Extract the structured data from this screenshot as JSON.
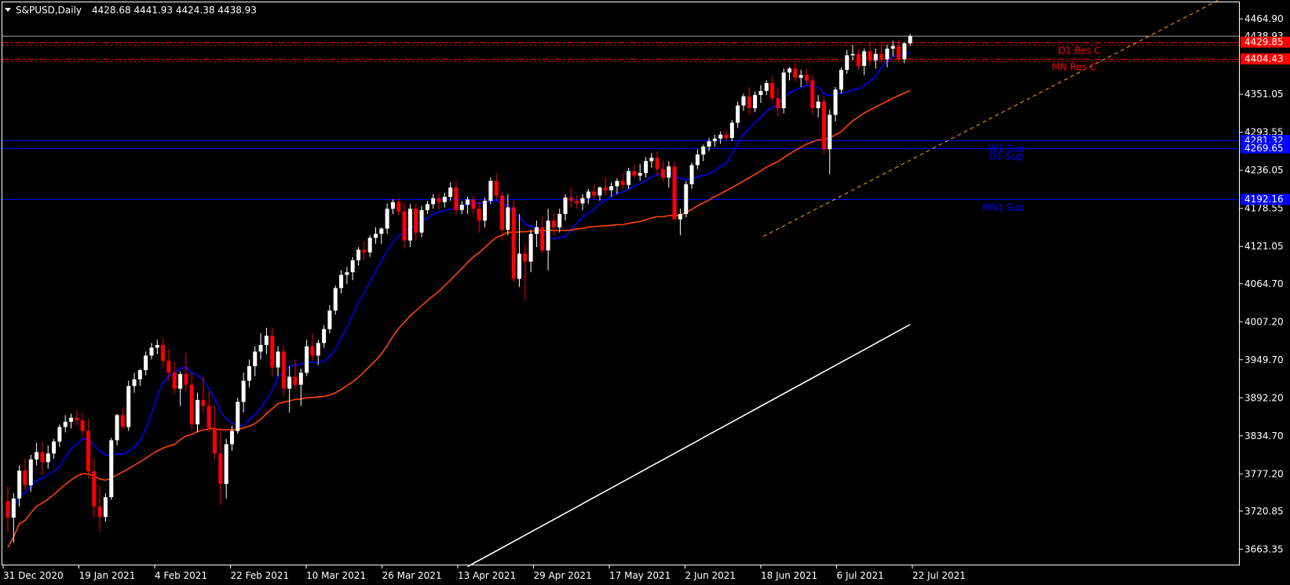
{
  "header": {
    "symbol": "S&PUSD,Daily",
    "ohlc": "4428.68 4441.93 4424.38 4438.93"
  },
  "chart_data": {
    "type": "candlestick",
    "title": "S&PUSD,Daily",
    "ylim": [
      3640,
      4490
    ],
    "y_ticks": [
      "4464.90",
      "4351.05",
      "4293.55",
      "4236.05",
      "4178.55",
      "4121.05",
      "4064.70",
      "4007.20",
      "3949.70",
      "3892.20",
      "3834.70",
      "3777.20",
      "3720.85",
      "3663.35"
    ],
    "x_ticks": [
      "31 Dec 2020",
      "19 Jan 2021",
      "4 Feb 2021",
      "22 Feb 2021",
      "10 Mar 2021",
      "26 Mar 2021",
      "13 Apr 2021",
      "29 Apr 2021",
      "17 May 2021",
      "2 Jun 2021",
      "18 Jun 2021",
      "6 Jul 2021",
      "22 Jul 2021"
    ],
    "last_price": "4438.93",
    "levels": [
      {
        "name": "D1 Res C",
        "price": 4429.85,
        "label": "4429.85",
        "color": "#ff0000",
        "style": "dashdot"
      },
      {
        "name": "MN Res C",
        "price": 4404.43,
        "label": "4404.43",
        "color": "#ff0000",
        "style": "dashdot"
      },
      {
        "name": "W1 Sup",
        "price": 4281.32,
        "label": "4281.32",
        "color": "#0000ff",
        "style": "solid"
      },
      {
        "name": "D1 Sup",
        "price": 4269.65,
        "label": "4269.65",
        "color": "#0000ff",
        "style": "solid"
      },
      {
        "name": "MN1 Sup",
        "price": 4192.16,
        "label": "4192.16",
        "color": "#0000ff",
        "style": "solid"
      }
    ],
    "trendline": {
      "start": {
        "date": "18 Jun 2021",
        "price": 4136
      },
      "end": {
        "date": "Aug 2021",
        "price": 4496
      },
      "color": "#ffa500",
      "style": "dashed"
    },
    "moving_averages": [
      {
        "color": "#0000ff",
        "period_label": "short"
      },
      {
        "color": "#ff4500",
        "period_label": "medium"
      },
      {
        "color": "#ffffff",
        "period_label": "long"
      }
    ],
    "candles": [
      [
        3736,
        3758,
        3690,
        3711
      ],
      [
        3711,
        3748,
        3673,
        3740
      ],
      [
        3740,
        3790,
        3728,
        3782
      ],
      [
        3782,
        3800,
        3752,
        3760
      ],
      [
        3760,
        3806,
        3750,
        3799
      ],
      [
        3799,
        3824,
        3790,
        3810
      ],
      [
        3810,
        3826,
        3775,
        3795
      ],
      [
        3795,
        3820,
        3785,
        3808
      ],
      [
        3808,
        3830,
        3800,
        3826
      ],
      [
        3826,
        3852,
        3818,
        3848
      ],
      [
        3848,
        3866,
        3840,
        3856
      ],
      [
        3856,
        3868,
        3846,
        3862
      ],
      [
        3862,
        3872,
        3850,
        3858
      ],
      [
        3858,
        3870,
        3836,
        3842
      ],
      [
        3842,
        3860,
        3770,
        3781
      ],
      [
        3781,
        3800,
        3712,
        3728
      ],
      [
        3728,
        3760,
        3690,
        3712
      ],
      [
        3712,
        3748,
        3705,
        3742
      ],
      [
        3742,
        3832,
        3738,
        3828
      ],
      [
        3828,
        3868,
        3820,
        3866
      ],
      [
        3866,
        3878,
        3845,
        3848
      ],
      [
        3848,
        3918,
        3842,
        3910
      ],
      [
        3910,
        3930,
        3900,
        3920
      ],
      [
        3920,
        3936,
        3910,
        3934
      ],
      [
        3934,
        3962,
        3926,
        3956
      ],
      [
        3956,
        3975,
        3950,
        3968
      ],
      [
        3968,
        3980,
        3958,
        3972
      ],
      [
        3972,
        3982,
        3938,
        3948
      ],
      [
        3948,
        3966,
        3918,
        3930
      ],
      [
        3930,
        3946,
        3898,
        3906
      ],
      [
        3906,
        3932,
        3880,
        3928
      ],
      [
        3928,
        3960,
        3902,
        3912
      ],
      [
        3912,
        3930,
        3842,
        3852
      ],
      [
        3852,
        3900,
        3840,
        3889
      ],
      [
        3889,
        3924,
        3870,
        3880
      ],
      [
        3880,
        3902,
        3840,
        3846
      ],
      [
        3846,
        3880,
        3800,
        3808
      ],
      [
        3808,
        3848,
        3730,
        3762
      ],
      [
        3762,
        3830,
        3740,
        3822
      ],
      [
        3822,
        3850,
        3812,
        3842
      ],
      [
        3842,
        3892,
        3838,
        3886
      ],
      [
        3886,
        3930,
        3870,
        3918
      ],
      [
        3918,
        3950,
        3908,
        3940
      ],
      [
        3940,
        3970,
        3925,
        3962
      ],
      [
        3962,
        3990,
        3950,
        3972
      ],
      [
        3972,
        3998,
        3958,
        3986
      ],
      [
        3986,
        3998,
        3925,
        3938
      ],
      [
        3938,
        3970,
        3925,
        3962
      ],
      [
        3962,
        3970,
        3895,
        3906
      ],
      [
        3906,
        3940,
        3870,
        3924
      ],
      [
        3924,
        3950,
        3905,
        3912
      ],
      [
        3912,
        3936,
        3880,
        3930
      ],
      [
        3930,
        3980,
        3925,
        3970
      ],
      [
        3970,
        3990,
        3948,
        3956
      ],
      [
        3956,
        3980,
        3942,
        3975
      ],
      [
        3975,
        4002,
        3968,
        3996
      ],
      [
        3996,
        4032,
        3990,
        4024
      ],
      [
        4024,
        4062,
        4018,
        4058
      ],
      [
        4058,
        4085,
        4050,
        4078
      ],
      [
        4078,
        4090,
        4064,
        4082
      ],
      [
        4082,
        4105,
        4070,
        4100
      ],
      [
        4100,
        4120,
        4092,
        4116
      ],
      [
        4116,
        4128,
        4100,
        4112
      ],
      [
        4112,
        4138,
        4105,
        4134
      ],
      [
        4134,
        4150,
        4125,
        4140
      ],
      [
        4140,
        4150,
        4125,
        4148
      ],
      [
        4148,
        4186,
        4140,
        4178
      ],
      [
        4178,
        4192,
        4170,
        4188
      ],
      [
        4188,
        4194,
        4168,
        4174
      ],
      [
        4174,
        4186,
        4118,
        4130
      ],
      [
        4130,
        4185,
        4120,
        4178
      ],
      [
        4178,
        4186,
        4130,
        4142
      ],
      [
        4142,
        4182,
        4135,
        4176
      ],
      [
        4176,
        4190,
        4170,
        4185
      ],
      [
        4185,
        4200,
        4178,
        4194
      ],
      [
        4194,
        4200,
        4176,
        4188
      ],
      [
        4188,
        4202,
        4180,
        4196
      ],
      [
        4196,
        4218,
        4190,
        4210
      ],
      [
        4210,
        4220,
        4168,
        4176
      ],
      [
        4176,
        4190,
        4170,
        4184
      ],
      [
        4184,
        4196,
        4170,
        4192
      ],
      [
        4192,
        4198,
        4170,
        4178
      ],
      [
        4178,
        4188,
        4142,
        4160
      ],
      [
        4160,
        4195,
        4150,
        4190
      ],
      [
        4190,
        4225,
        4185,
        4220
      ],
      [
        4220,
        4232,
        4190,
        4198
      ],
      [
        4198,
        4204,
        4130,
        4146
      ],
      [
        4146,
        4200,
        4138,
        4180
      ],
      [
        4180,
        4190,
        4068,
        4072
      ],
      [
        4072,
        4170,
        4060,
        4110
      ],
      [
        4110,
        4124,
        4040,
        4098
      ],
      [
        4098,
        4146,
        4082,
        4140
      ],
      [
        4140,
        4160,
        4120,
        4150
      ],
      [
        4150,
        4166,
        4110,
        4115
      ],
      [
        4115,
        4178,
        4085,
        4160
      ],
      [
        4160,
        4172,
        4138,
        4150
      ],
      [
        4150,
        4178,
        4142,
        4170
      ],
      [
        4170,
        4200,
        4160,
        4195
      ],
      [
        4195,
        4210,
        4180,
        4190
      ],
      [
        4190,
        4198,
        4178,
        4186
      ],
      [
        4186,
        4200,
        4176,
        4194
      ],
      [
        4194,
        4208,
        4185,
        4204
      ],
      [
        4204,
        4215,
        4192,
        4198
      ],
      [
        4198,
        4212,
        4190,
        4210
      ],
      [
        4210,
        4225,
        4198,
        4206
      ],
      [
        4206,
        4218,
        4196,
        4212
      ],
      [
        4212,
        4224,
        4200,
        4220
      ],
      [
        4220,
        4232,
        4208,
        4214
      ],
      [
        4214,
        4240,
        4208,
        4235
      ],
      [
        4235,
        4245,
        4225,
        4228
      ],
      [
        4228,
        4246,
        4220,
        4232
      ],
      [
        4232,
        4256,
        4225,
        4250
      ],
      [
        4250,
        4262,
        4240,
        4255
      ],
      [
        4255,
        4265,
        4228,
        4238
      ],
      [
        4238,
        4250,
        4220,
        4225
      ],
      [
        4225,
        4250,
        4210,
        4242
      ],
      [
        4242,
        4248,
        4175,
        4162
      ],
      [
        4162,
        4178,
        4138,
        4170
      ],
      [
        4170,
        4220,
        4165,
        4215
      ],
      [
        4215,
        4248,
        4208,
        4244
      ],
      [
        4244,
        4268,
        4238,
        4260
      ],
      [
        4260,
        4275,
        4250,
        4272
      ],
      [
        4272,
        4285,
        4265,
        4280
      ],
      [
        4280,
        4290,
        4272,
        4284
      ],
      [
        4284,
        4295,
        4276,
        4290
      ],
      [
        4290,
        4298,
        4280,
        4285
      ],
      [
        4285,
        4312,
        4280,
        4308
      ],
      [
        4308,
        4340,
        4300,
        4334
      ],
      [
        4334,
        4352,
        4326,
        4348
      ],
      [
        4348,
        4362,
        4320,
        4330
      ],
      [
        4330,
        4355,
        4324,
        4350
      ],
      [
        4350,
        4365,
        4338,
        4356
      ],
      [
        4356,
        4372,
        4350,
        4368
      ],
      [
        4368,
        4378,
        4340,
        4345
      ],
      [
        4345,
        4360,
        4318,
        4330
      ],
      [
        4330,
        4390,
        4322,
        4384
      ],
      [
        4384,
        4392,
        4372,
        4390
      ],
      [
        4390,
        4398,
        4370,
        4376
      ],
      [
        4376,
        4388,
        4362,
        4380
      ],
      [
        4380,
        4390,
        4366,
        4372
      ],
      [
        4372,
        4380,
        4320,
        4330
      ],
      [
        4330,
        4350,
        4316,
        4340
      ],
      [
        4340,
        4348,
        4260,
        4268
      ],
      [
        4268,
        4328,
        4230,
        4320
      ],
      [
        4320,
        4362,
        4310,
        4358
      ],
      [
        4358,
        4392,
        4352,
        4388
      ],
      [
        4388,
        4418,
        4382,
        4410
      ],
      [
        4410,
        4426,
        4402,
        4412
      ],
      [
        4412,
        4420,
        4388,
        4394
      ],
      [
        4394,
        4420,
        4380,
        4416
      ],
      [
        4416,
        4430,
        4395,
        4402
      ],
      [
        4402,
        4420,
        4390,
        4412
      ],
      [
        4412,
        4430,
        4398,
        4404
      ],
      [
        4404,
        4426,
        4392,
        4420
      ],
      [
        4420,
        4432,
        4408,
        4424
      ],
      [
        4424,
        4434,
        4400,
        4404
      ],
      [
        4404,
        4430,
        4398,
        4428
      ],
      [
        4428,
        4442,
        4424,
        4439
      ]
    ]
  },
  "colors": {
    "background": "#000000",
    "bull": "#ffffff",
    "bear": "#ff0000",
    "axis": "#ffffff",
    "price_line": "#a0a0a0"
  }
}
